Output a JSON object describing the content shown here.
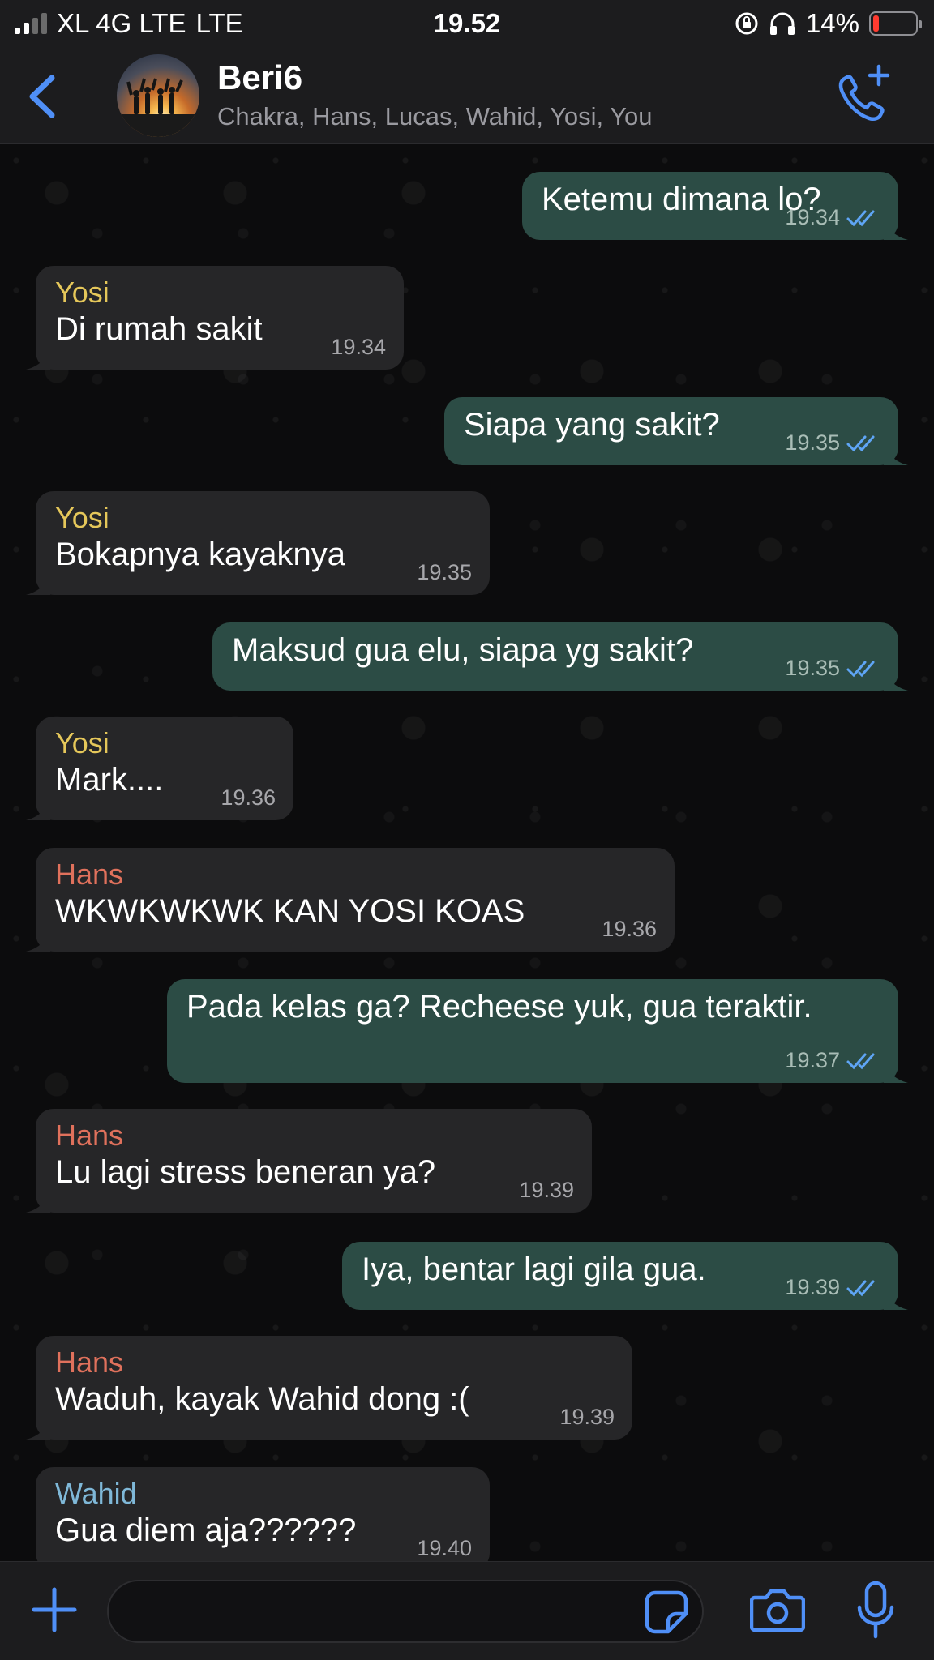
{
  "status_bar": {
    "carrier": "XL 4G LTE",
    "network": "LTE",
    "time": "19.52",
    "battery": "14%",
    "battery_level": 0.14
  },
  "header": {
    "title": "Beri6",
    "members": "Chakra, Hans, Lucas, Wahid, Yosi, You",
    "back_icon": "chevron-left-icon",
    "call_icon": "add-call-icon"
  },
  "colors": {
    "accent": "#4f8ff7",
    "incoming_bubble": "#262628",
    "outgoing_bubble": "#2c4c45",
    "yosi": "#e5c75a",
    "hans": "#e0715c",
    "wahid": "#7fb8d8"
  },
  "messages": [
    {
      "dir": "out",
      "text": "Ketemu dimana lo?",
      "time": "19.34"
    },
    {
      "dir": "in",
      "sender": "Yosi",
      "text": "Di rumah sakit",
      "time": "19.34"
    },
    {
      "dir": "out",
      "text": "Siapa yang sakit?",
      "time": "19.35"
    },
    {
      "dir": "in",
      "sender": "Yosi",
      "text": "Bokapnya kayaknya",
      "time": "19.35"
    },
    {
      "dir": "out",
      "text": "Maksud gua elu, siapa yg sakit?",
      "time": "19.35"
    },
    {
      "dir": "in",
      "sender": "Yosi",
      "text": "Mark....",
      "time": "19.36"
    },
    {
      "dir": "in",
      "sender": "Hans",
      "text": "WKWKWKWK KAN YOSI KOAS",
      "time": "19.36"
    },
    {
      "dir": "out",
      "text": "Pada kelas ga? Recheese yuk, gua teraktir.",
      "time": "19.37"
    },
    {
      "dir": "in",
      "sender": "Hans",
      "text": "Lu lagi stress beneran ya?",
      "time": "19.39"
    },
    {
      "dir": "out",
      "text": "Iya, bentar lagi gila gua.",
      "time": "19.39"
    },
    {
      "dir": "in",
      "sender": "Hans",
      "text": "Waduh, kayak Wahid dong :(",
      "time": "19.39"
    },
    {
      "dir": "in",
      "sender": "Wahid",
      "text": "Gua diem aja??????",
      "time": "19.40"
    }
  ],
  "input_bar": {
    "plus_icon": "plus-icon",
    "sticker_icon": "sticker-icon",
    "camera_icon": "camera-icon",
    "mic_icon": "microphone-icon"
  }
}
